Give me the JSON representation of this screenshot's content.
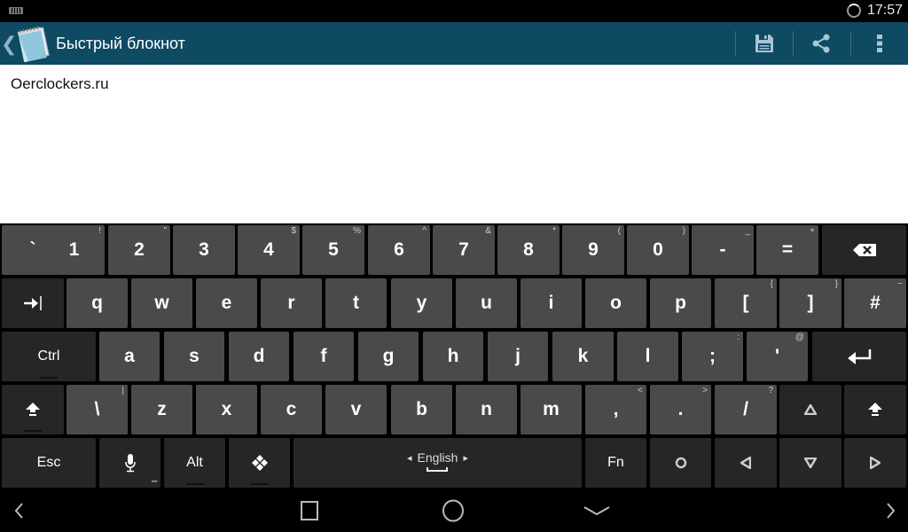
{
  "status_bar": {
    "time": "17:57",
    "keyboard_indicator_icon": "keyboard-icon",
    "sync_icon": "sync-spinner-icon"
  },
  "action_bar": {
    "title": "Быстрый блокнот",
    "up_icon": "chevron-left-icon",
    "app_icon": "notepad-icon",
    "actions": [
      {
        "name": "save",
        "icon": "floppy-disk-icon"
      },
      {
        "name": "share",
        "icon": "share-icon"
      },
      {
        "name": "overflow",
        "icon": "more-vertical-icon"
      }
    ],
    "color": "#0e4a62"
  },
  "editor": {
    "content": "Oerclockers.ru"
  },
  "keyboard": {
    "language": "English",
    "rows": [
      [
        {
          "label": "`",
          "hint": ""
        },
        {
          "label": "1",
          "hint": "!"
        },
        {
          "label": "2",
          "hint": "\""
        },
        {
          "label": "3",
          "hint": ""
        },
        {
          "label": "4",
          "hint": "$"
        },
        {
          "label": "5",
          "hint": "%"
        },
        {
          "label": "6",
          "hint": "^"
        },
        {
          "label": "7",
          "hint": "&"
        },
        {
          "label": "8",
          "hint": "*"
        },
        {
          "label": "9",
          "hint": "("
        },
        {
          "label": "0",
          "hint": ")"
        },
        {
          "label": "-",
          "hint": "_"
        },
        {
          "label": "=",
          "hint": "+"
        },
        {
          "label": "⌫",
          "hint": "",
          "mod": true,
          "name": "backspace"
        }
      ],
      [
        {
          "label": "⇥",
          "hint": "",
          "mod": true,
          "name": "tab"
        },
        {
          "label": "q",
          "hint": ""
        },
        {
          "label": "w",
          "hint": ""
        },
        {
          "label": "e",
          "hint": ""
        },
        {
          "label": "r",
          "hint": ""
        },
        {
          "label": "t",
          "hint": ""
        },
        {
          "label": "y",
          "hint": ""
        },
        {
          "label": "u",
          "hint": ""
        },
        {
          "label": "i",
          "hint": ""
        },
        {
          "label": "o",
          "hint": ""
        },
        {
          "label": "p",
          "hint": ""
        },
        {
          "label": "[",
          "hint": "{"
        },
        {
          "label": "]",
          "hint": "}"
        },
        {
          "label": "#",
          "hint": "~"
        }
      ],
      [
        {
          "label": "Ctrl",
          "hint": "",
          "mod": true,
          "name": "ctrl"
        },
        {
          "label": "a",
          "hint": ""
        },
        {
          "label": "s",
          "hint": ""
        },
        {
          "label": "d",
          "hint": ""
        },
        {
          "label": "f",
          "hint": ""
        },
        {
          "label": "g",
          "hint": ""
        },
        {
          "label": "h",
          "hint": ""
        },
        {
          "label": "j",
          "hint": ""
        },
        {
          "label": "k",
          "hint": ""
        },
        {
          "label": "l",
          "hint": ""
        },
        {
          "label": ";",
          "hint": ":"
        },
        {
          "label": "'",
          "hint": "@"
        },
        {
          "label": "↵",
          "hint": "",
          "mod": true,
          "name": "enter"
        }
      ],
      [
        {
          "label": "⇧",
          "hint": "",
          "mod": true,
          "name": "shift-left"
        },
        {
          "label": "\\",
          "hint": "|"
        },
        {
          "label": "z",
          "hint": ""
        },
        {
          "label": "x",
          "hint": ""
        },
        {
          "label": "c",
          "hint": ""
        },
        {
          "label": "v",
          "hint": ""
        },
        {
          "label": "b",
          "hint": ""
        },
        {
          "label": "n",
          "hint": ""
        },
        {
          "label": "m",
          "hint": ""
        },
        {
          "label": ",",
          "hint": "<"
        },
        {
          "label": ".",
          "hint": ">"
        },
        {
          "label": "/",
          "hint": "?"
        },
        {
          "label": "▲",
          "hint": "",
          "mod": true,
          "name": "arrow-up"
        },
        {
          "label": "⇧",
          "hint": "",
          "mod": true,
          "name": "shift-right"
        }
      ],
      [
        {
          "label": "Esc",
          "hint": "",
          "mod": true,
          "name": "esc"
        },
        {
          "label": "🎤",
          "hint": "",
          "mod": true,
          "name": "voice"
        },
        {
          "label": "Alt",
          "hint": "",
          "mod": true,
          "name": "alt"
        },
        {
          "label": "❖",
          "hint": "",
          "mod": true,
          "name": "meta"
        },
        {
          "label": "English",
          "hint": "",
          "mod": true,
          "name": "space"
        },
        {
          "label": "Fn",
          "hint": "",
          "mod": true,
          "name": "fn"
        },
        {
          "label": "○",
          "hint": "",
          "mod": true,
          "name": "home"
        },
        {
          "label": "◀",
          "hint": "",
          "mod": true,
          "name": "arrow-left"
        },
        {
          "label": "▼",
          "hint": "",
          "mod": true,
          "name": "arrow-down"
        },
        {
          "label": "▶",
          "hint": "",
          "mod": true,
          "name": "arrow-right"
        }
      ]
    ]
  },
  "nav_bar": {
    "buttons": [
      {
        "name": "prev",
        "icon": "chevron-left-icon"
      },
      {
        "name": "recents",
        "icon": "square-icon"
      },
      {
        "name": "home",
        "icon": "circle-icon"
      },
      {
        "name": "hide-keyboard",
        "icon": "chevron-down-icon"
      },
      {
        "name": "next",
        "icon": "chevron-right-icon"
      }
    ]
  }
}
